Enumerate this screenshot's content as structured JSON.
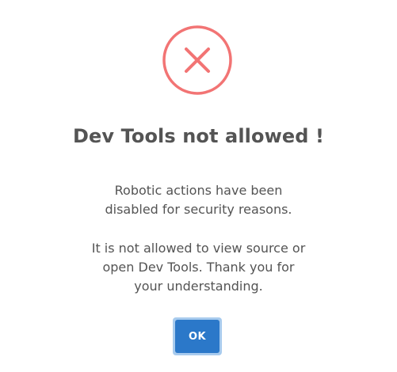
{
  "dialog": {
    "icon": "error-x-icon",
    "title": "Dev Tools not allowed !",
    "message_lines_1": [
      "Robotic actions have been",
      "disabled for security reasons."
    ],
    "message_lines_2": [
      "It is not allowed to view source or",
      "open Dev Tools. Thank you for",
      "your understanding."
    ],
    "ok_label": "OK"
  },
  "colors": {
    "icon_red": "#f27474",
    "text": "#545454",
    "button": "#2b78c9",
    "button_focus_ring": "#a8cbee"
  }
}
